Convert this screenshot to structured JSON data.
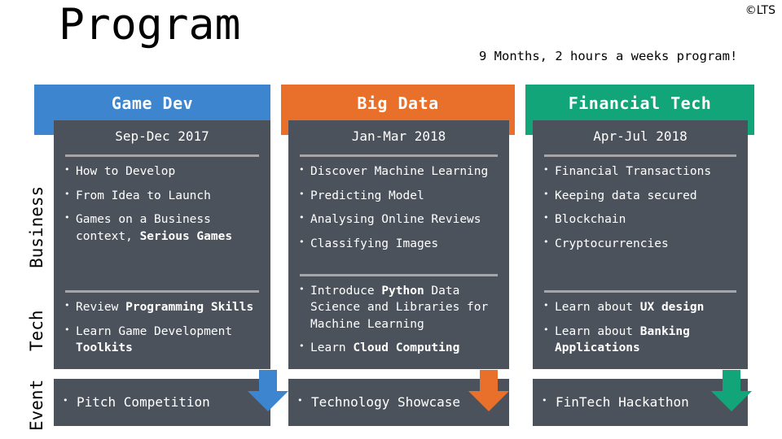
{
  "header": {
    "title": "Program",
    "copyright": "©LTS",
    "subtitle": "9 Months, 2 hours a weeks program!"
  },
  "side_labels": {
    "business": "Business",
    "tech": "Tech",
    "event": "Event"
  },
  "colors": {
    "game_dev": "#3d85ce",
    "big_data": "#e8702a",
    "financial_tech": "#11a579",
    "panel": "#4c525c",
    "divider": "#a6a6a6",
    "text": "#ffffff",
    "page_background": "#ffffff"
  },
  "columns": [
    {
      "title": "Game Dev",
      "color": "#3d85ce",
      "period": "Sep-Dec 2017",
      "business": [
        [
          {
            "t": "How to Develop",
            "b": false
          }
        ],
        [
          {
            "t": "From Idea to Launch",
            "b": false
          }
        ],
        [
          {
            "t": "Games on a Business context, ",
            "b": false
          },
          {
            "t": "Serious Games",
            "b": true
          }
        ]
      ],
      "tech": [
        [
          {
            "t": "Review ",
            "b": false
          },
          {
            "t": "Programming Skills",
            "b": true
          }
        ],
        [
          {
            "t": "Learn Game Development ",
            "b": false
          },
          {
            "t": "Toolkits",
            "b": true
          }
        ]
      ],
      "event": [
        [
          {
            "t": "Pitch Competition",
            "b": false
          }
        ]
      ],
      "arrow": "down-arrow-icon"
    },
    {
      "title": "Big Data",
      "color": "#e8702a",
      "period": "Jan-Mar 2018",
      "business": [
        [
          {
            "t": "Discover Machine Learning",
            "b": false
          }
        ],
        [
          {
            "t": "Predicting Model",
            "b": false
          }
        ],
        [
          {
            "t": "Analysing Online Reviews",
            "b": false
          }
        ],
        [
          {
            "t": "Classifying Images",
            "b": false
          }
        ]
      ],
      "tech": [
        [
          {
            "t": "Introduce ",
            "b": false
          },
          {
            "t": "Python",
            "b": true
          },
          {
            "t": " Data Science and Libraries for Machine Learning",
            "b": false
          }
        ],
        [
          {
            "t": "Learn ",
            "b": false
          },
          {
            "t": "Cloud Computing",
            "b": true
          }
        ]
      ],
      "event": [
        [
          {
            "t": "Technology Showcase",
            "b": false
          }
        ]
      ],
      "arrow": "down-arrow-icon"
    },
    {
      "title": "Financial Tech",
      "color": "#11a579",
      "period": "Apr-Jul 2018",
      "business": [
        [
          {
            "t": "Financial Transactions",
            "b": false
          }
        ],
        [
          {
            "t": "Keeping data secured",
            "b": false
          }
        ],
        [
          {
            "t": "Blockchain",
            "b": false
          }
        ],
        [
          {
            "t": "Cryptocurrencies",
            "b": false
          }
        ]
      ],
      "tech": [
        [
          {
            "t": "Learn about ",
            "b": false
          },
          {
            "t": "UX design",
            "b": true
          }
        ],
        [
          {
            "t": "Learn about ",
            "b": false
          },
          {
            "t": "Banking Applications",
            "b": true
          }
        ]
      ],
      "event": [
        [
          {
            "t": "FinTech Hackathon",
            "b": false
          }
        ]
      ],
      "arrow": "down-arrow-icon"
    }
  ]
}
